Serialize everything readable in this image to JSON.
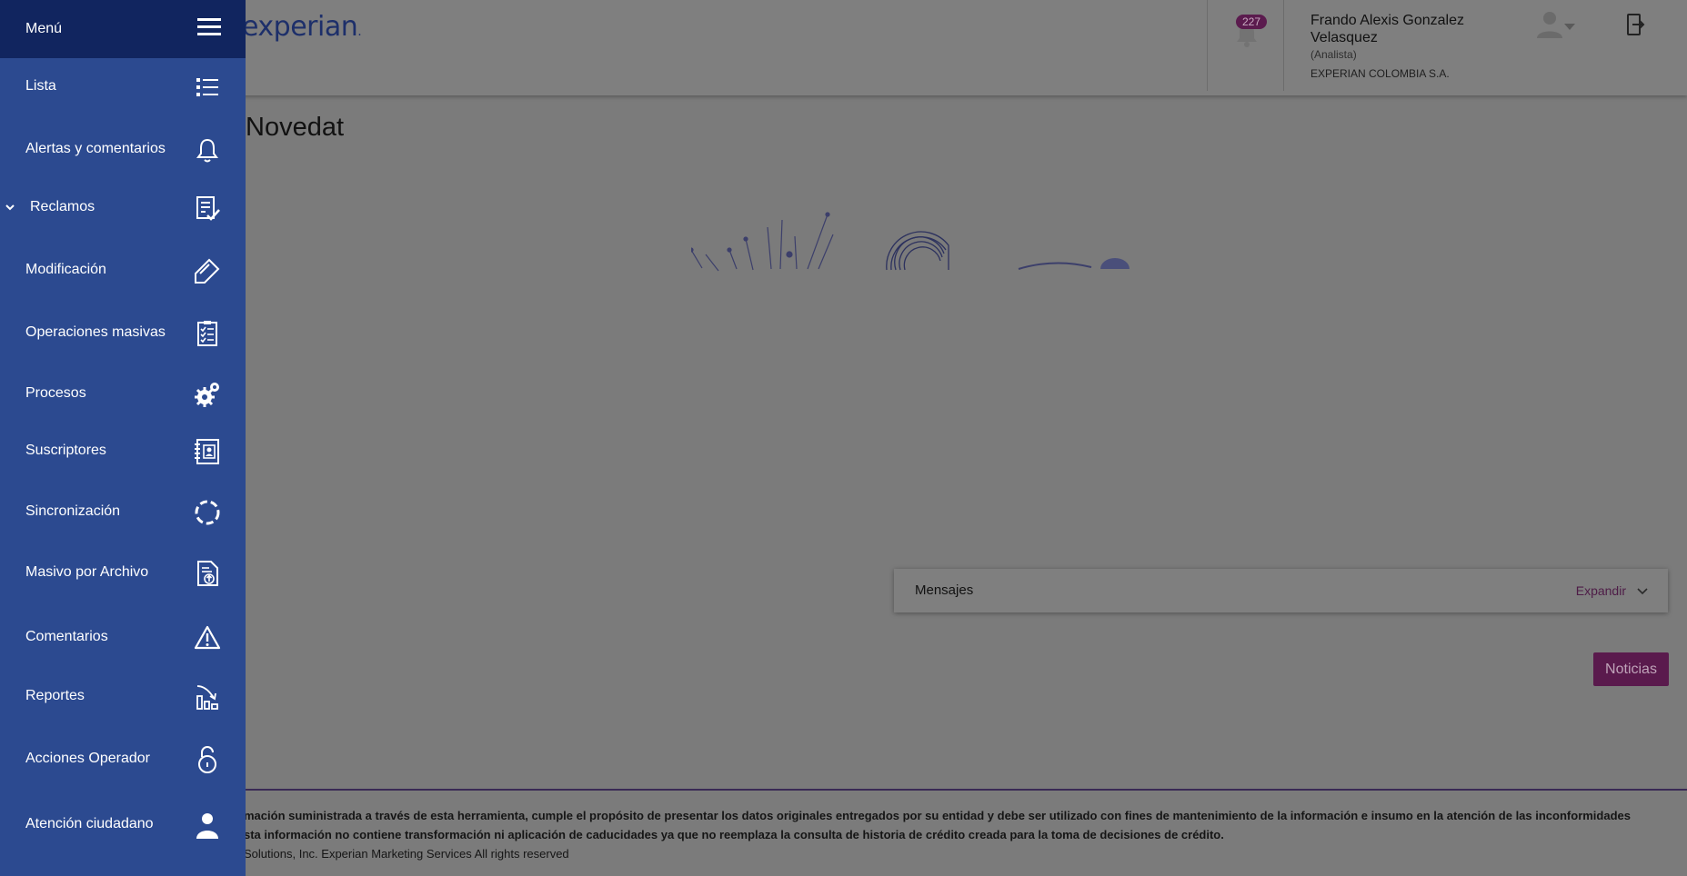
{
  "header": {
    "logo_text": "experian",
    "notification_count": "227",
    "user": {
      "name": "Frando Alexis Gonzalez Velasquez",
      "role": "(Analista)",
      "organization": "EXPERIAN COLOMBIA S.A."
    },
    "icons": [
      "bell-icon",
      "user-avatar-icon",
      "logout-icon"
    ]
  },
  "sidebar": {
    "title": "Menú",
    "items": [
      {
        "label": "Lista",
        "icon": "list-icon"
      },
      {
        "label": "Alertas y comentarios",
        "icon": "bell-icon"
      },
      {
        "label": "Reclamos",
        "icon": "claims-icon",
        "expandable": true
      },
      {
        "label": "Modificación",
        "icon": "edit-tag-icon"
      },
      {
        "label": "Operaciones masivas",
        "icon": "checklist-icon"
      },
      {
        "label": "Procesos",
        "icon": "gears-icon"
      },
      {
        "label": "Suscriptores",
        "icon": "contacts-book-icon"
      },
      {
        "label": "Sincronización",
        "icon": "sync-circle-icon"
      },
      {
        "label": "Masivo por Archivo",
        "icon": "file-upload-icon"
      },
      {
        "label": "Comentarios",
        "icon": "warning-icon"
      },
      {
        "label": "Reportes",
        "icon": "report-chart-icon"
      },
      {
        "label": "Acciones Operador",
        "icon": "unlock-icon"
      },
      {
        "label": "Atención ciudadano",
        "icon": "person-icon"
      }
    ]
  },
  "main": {
    "page_title": "Novedat",
    "messages_panel": {
      "label": "Mensajes",
      "expand_label": "Expandir"
    },
    "news_button": "Noticias"
  },
  "footer": {
    "line1": "mación suministrada a través de esta herramienta, cumple el propósito de presentar los datos originales entregados por su entidad y debe ser utilizado con fines de mantenimiento de la información e insumo en la atención de las inconformidades",
    "line2": "sta información no contiene transformación ni aplicación de caducidades ya que no reemplaza la consulta de historia de crédito creada para la toma de decisiones de crédito.",
    "line3": "Solutions, Inc. Experian Marketing Services All rights reserved"
  },
  "colors": {
    "sidebar_bg": "#2c4a90",
    "sidebar_header_bg": "#11255f",
    "overlay_bg": "#7f7f7f",
    "accent_purple": "#5a1a4d",
    "brand_blue": "#1d2f6a"
  }
}
